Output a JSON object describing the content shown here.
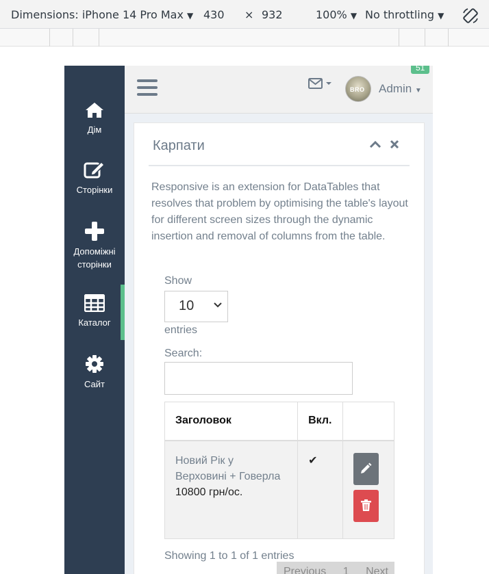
{
  "devtools": {
    "dimensions_label": "Dimensions: iPhone 14 Pro Max",
    "width": "430",
    "times": "×",
    "height": "932",
    "zoom": "100%",
    "throttling": "No throttling"
  },
  "sidebar": {
    "items": [
      {
        "label": "Дім",
        "icon": "home-icon"
      },
      {
        "label": "Сторінки",
        "icon": "edit-icon"
      },
      {
        "label": "Допоміжні сторінки",
        "icon": "plus-icon"
      },
      {
        "label": "Каталог",
        "icon": "table-icon"
      },
      {
        "label": "Сайт",
        "icon": "gear-icon"
      }
    ],
    "active_index": 3
  },
  "topbar": {
    "user_name": "Admin",
    "avatar_text": "BRO",
    "badge": "51"
  },
  "box": {
    "title": "Карпати",
    "description": "Responsive is an extension for DataTables that resolves that problem by optimising the table's layout for different screen sizes through the dynamic insertion and removal of columns from the table."
  },
  "datatable": {
    "show_label": "Show",
    "page_length": "10",
    "entries_label": "entries",
    "search_label": "Search:",
    "search_value": "",
    "columns": [
      "Заголовок",
      "Вкл.",
      ""
    ],
    "rows": [
      {
        "title": "Новий Рік у Верховині + Говерла",
        "price": "10800 грн/ос.",
        "enabled": "✔"
      }
    ],
    "info": "Showing 1 to 1 of 1 entries",
    "pagination": {
      "previous": "Previous",
      "page": "1",
      "next": "Next"
    }
  },
  "colors": {
    "sidebar_bg": "#2e3e52",
    "accent_green": "#5cbf8c",
    "edit_button": "#6c737a",
    "delete_button": "#dd4b50"
  }
}
